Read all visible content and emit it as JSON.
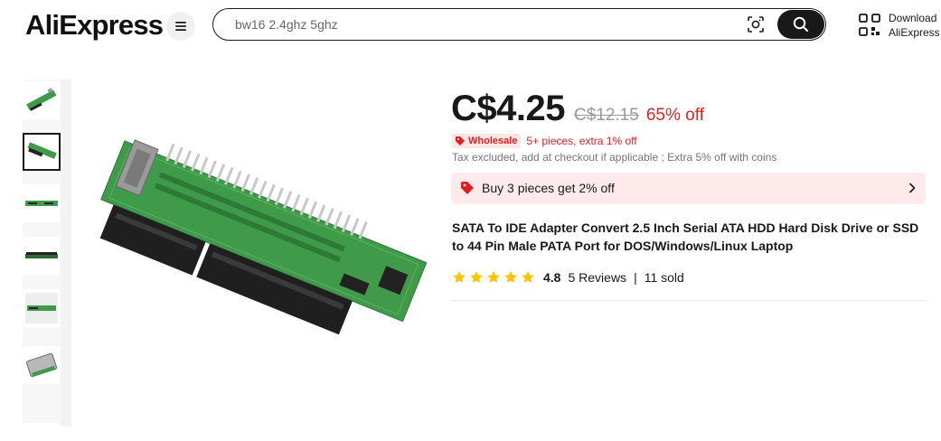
{
  "header": {
    "logo_text": "AliExpress",
    "search": {
      "value": "bw16 2.4ghz 5ghz"
    },
    "download_line1": "Download",
    "download_line2": "AliExpress"
  },
  "product": {
    "price": "C$4.25",
    "original_price": "C$12.15",
    "discount": "65% off",
    "wholesale_label": "Wholesale",
    "wholesale_text": "5+ pieces, extra 1% off",
    "tax_note": "Tax excluded, add at checkout if applicable ; Extra 5% off with coins",
    "promo_text": "Buy 3 pieces get 2% off",
    "title": "SATA To IDE Adapter Convert 2.5 Inch Serial ATA HDD Hard Disk Drive or SSD to 44 Pin Male PATA Port for DOS/Windows/Linux Laptop",
    "rating": {
      "stars": 5,
      "value": "4.8"
    },
    "reviews": "5 Reviews",
    "separator": "|",
    "sold": "11 sold"
  },
  "colors": {
    "accent_red": "#e02020",
    "star": "#fdc400",
    "promo_bg": "#ffeaeb",
    "pcb_green": "#3f9a4a"
  },
  "gallery": {
    "thumbnail_count": 6,
    "active_index": 1
  }
}
